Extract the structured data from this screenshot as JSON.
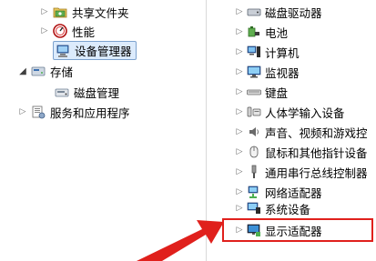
{
  "left_tree": {
    "items": [
      {
        "label": "共享文件夹",
        "icon": "shared-folder-icon",
        "expanded": false
      },
      {
        "label": "性能",
        "icon": "performance-icon",
        "expanded": false
      },
      {
        "label": "设备管理器",
        "icon": "device-manager-icon",
        "selected": true
      },
      {
        "label": "存储",
        "icon": "storage-icon",
        "expanded": true
      },
      {
        "label": "磁盘管理",
        "icon": "disk-management-icon"
      },
      {
        "label": "服务和应用程序",
        "icon": "services-apps-icon",
        "expanded": false
      }
    ]
  },
  "device_list": {
    "items": [
      {
        "label": "磁盘驱动器",
        "icon": "disk-drive-icon"
      },
      {
        "label": "电池",
        "icon": "battery-icon"
      },
      {
        "label": "计算机",
        "icon": "computer-icon"
      },
      {
        "label": "监视器",
        "icon": "monitor-icon"
      },
      {
        "label": "键盘",
        "icon": "keyboard-icon"
      },
      {
        "label": "人体学输入设备",
        "icon": "hid-icon"
      },
      {
        "label": "声音、视频和游戏控",
        "icon": "sound-icon"
      },
      {
        "label": "鼠标和其他指针设备",
        "icon": "mouse-icon"
      },
      {
        "label": "通用串行总线控制器",
        "icon": "usb-icon"
      },
      {
        "label": "网络适配器",
        "icon": "network-adapter-icon"
      },
      {
        "label": "系统设备",
        "icon": "system-devices-icon"
      },
      {
        "label": "显示适配器",
        "icon": "display-adapter-icon",
        "highlighted": true
      }
    ]
  },
  "colors": {
    "annotation_red": "#e0201c",
    "selection_bg": "#dcebfc",
    "selection_border": "#7da2ce"
  }
}
